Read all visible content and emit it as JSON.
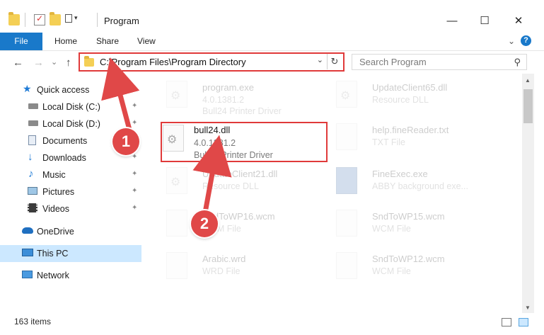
{
  "window": {
    "title": "Program",
    "minimize_glyph": "—",
    "maximize_glyph": "☐",
    "close_glyph": "✕"
  },
  "ribbon": {
    "tabs": [
      "File",
      "Home",
      "Share",
      "View"
    ],
    "help_glyph": "?",
    "expand_glyph": "⌄"
  },
  "address": {
    "path": "C:\\Program Files\\Program Directory",
    "dropdown_glyph": "⌄",
    "refresh_glyph": "↻",
    "back_glyph": "←",
    "forward_glyph": "→",
    "recent_glyph": "⌄",
    "up_glyph": "↑"
  },
  "search": {
    "placeholder": "Search Program",
    "icon_glyph": "⚲"
  },
  "sidebar": {
    "items": [
      {
        "label": "Quick access",
        "icon": "star-icon",
        "pinned": false
      },
      {
        "label": "Local Disk (C:)",
        "icon": "drive-icon",
        "pinned": true
      },
      {
        "label": "Local Disk (D:)",
        "icon": "drive-icon",
        "pinned": true
      },
      {
        "label": "Documents",
        "icon": "documents-icon",
        "pinned": true
      },
      {
        "label": "Downloads",
        "icon": "download-icon",
        "pinned": true
      },
      {
        "label": "Music",
        "icon": "music-icon",
        "pinned": true
      },
      {
        "label": "Pictures",
        "icon": "pictures-icon",
        "pinned": true
      },
      {
        "label": "Videos",
        "icon": "videos-icon",
        "pinned": true
      },
      {
        "label": "OneDrive",
        "icon": "cloud-icon",
        "pinned": false
      },
      {
        "label": "This PC",
        "icon": "computer-icon",
        "pinned": false,
        "selected": true
      },
      {
        "label": "Network",
        "icon": "network-icon",
        "pinned": false
      }
    ],
    "pin_glyph": "📌"
  },
  "files": [
    {
      "name": "program.exe",
      "line2": "4.0.1381.2",
      "line3": "Bull24 Printer Driver",
      "dimmed": true
    },
    {
      "name": "UpdateClient65.dll",
      "line2": "Resource DLL",
      "line3": "",
      "dimmed": true
    },
    {
      "name": "bull24.dll",
      "line2": "4.0.1381.2",
      "line3": "Bull24 Printer Driver",
      "dimmed": false
    },
    {
      "name": "help.fineReader.txt",
      "line2": "TXT File",
      "line3": "",
      "dimmed": true
    },
    {
      "name": "UpdateClient21.dll",
      "line2": "Resource DLL",
      "line3": "",
      "dimmed": true
    },
    {
      "name": "FineExec.exe",
      "line2": "ABBY background exe...",
      "line3": "",
      "dimmed": true
    },
    {
      "name": "SndToWP16.wcm",
      "line2": "WCM File",
      "line3": "",
      "dimmed": true
    },
    {
      "name": "SndToWP15.wcm",
      "line2": "WCM File",
      "line3": "",
      "dimmed": true
    },
    {
      "name": "Arabic.wrd",
      "line2": "WRD File",
      "line3": "",
      "dimmed": true
    },
    {
      "name": "SndToWP12.wcm",
      "line2": "WCM File",
      "line3": "",
      "dimmed": true
    }
  ],
  "status": {
    "item_count": "163 items"
  },
  "callouts": [
    "1",
    "2"
  ],
  "colors": {
    "accent": "#1979ca",
    "highlight": "#e03a3a",
    "selection": "#cce8ff",
    "callout": "#e04848"
  }
}
